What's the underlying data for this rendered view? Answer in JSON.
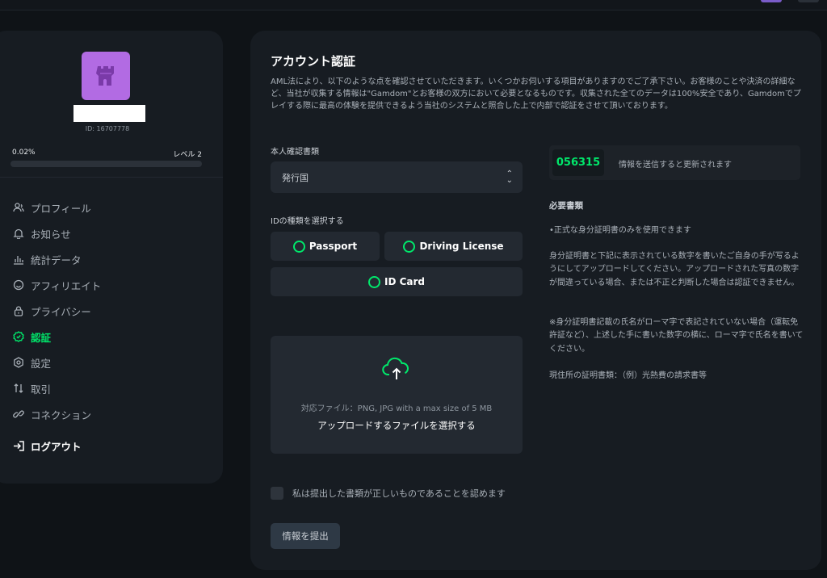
{
  "profile": {
    "user_id": "ID: 16707778",
    "progress_text": "0.02%",
    "progress_value": 0.0002,
    "level": "レベル 2"
  },
  "nav": {
    "items": [
      {
        "label": "プロフィール",
        "icon": "profile-icon"
      },
      {
        "label": "お知らせ",
        "icon": "bell-icon"
      },
      {
        "label": "統計データ",
        "icon": "stats-icon"
      },
      {
        "label": "アフィリエイト",
        "icon": "smile-icon"
      },
      {
        "label": "プライバシー",
        "icon": "lock-icon"
      },
      {
        "label": "認証",
        "icon": "verify-icon",
        "active": true
      },
      {
        "label": "設定",
        "icon": "gear-icon"
      },
      {
        "label": "取引",
        "icon": "transfer-icon"
      },
      {
        "label": "コネクション",
        "icon": "link-icon"
      }
    ],
    "logout": "ログアウト"
  },
  "verification": {
    "title": "アカウント認証",
    "description": "AML法により、以下のような点を確認させていただきます。いくつかお伺いする項目がありますのでご了承下さい。お客様のことや決済の詳細など、当社が収集する情報は\"Gamdom\"とお客様の双方において必要となるものです。収集された全てのデータは100%安全であり、Gamdomでプレイする際に最高の体験を提供できるよう当社のシステムと照合した上で内部で認証をさせて頂いております。",
    "doc_type_label": "本人確認書類",
    "country_select": "発行国",
    "id_type_label": "IDの種類を選択する",
    "id_options": {
      "passport": "Passport",
      "driving": "Driving License",
      "idcard": "ID Card"
    },
    "upload_types": "対応ファイル：PNG, JPG with a max size of 5 MB",
    "upload_choose": "アップロードするファイルを選択する",
    "agree": "私は提出した書類が正しいものであることを認めます",
    "submit": "情報を提出"
  },
  "requirements": {
    "code": "056315",
    "code_note": "情報を送信すると更新されます",
    "title": "必要書類",
    "line1": "•正式な身分証明書のみを使用できます",
    "para1": "身分証明書と下記に表示されている数字を書いたご自身の手が写るようにしてアップロードしてください。アップロードされた写真の数字が間違っている場合、または不正と判断した場合は認証できません。",
    "para2": "※身分証明書記載の氏名がローマ字で表記されていない場合（運転免許証など）、上述した手に書いた数字の横に、ローマ字で氏名を書いてください。",
    "para3": "現住所の証明書類：（例）光熱費の請求書等"
  },
  "colors": {
    "accent": "#00e86b",
    "avatar": "#b26be3",
    "panel": "#171c22",
    "background": "#0f1317"
  }
}
